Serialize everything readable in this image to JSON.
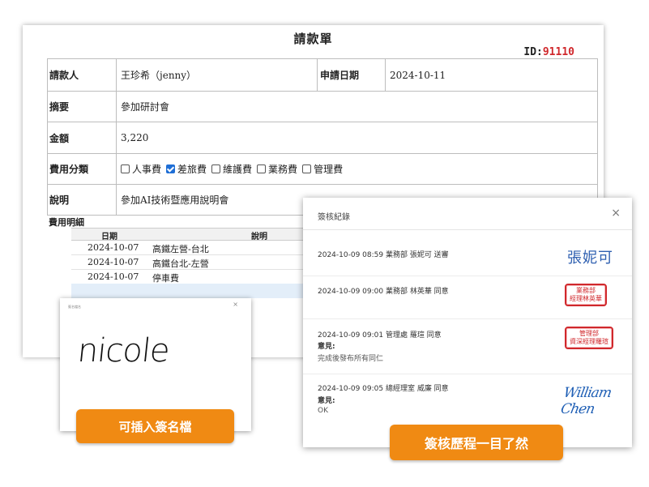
{
  "form": {
    "title": "請款單",
    "id_label": "ID:",
    "id_value": "91110",
    "applicant_label": "請款人",
    "applicant_value": "王珍希（jenny）",
    "date_label": "申請日期",
    "date_value": "2024-10-11",
    "summary_label": "摘要",
    "summary_value": "參加研討會",
    "amount_label": "金額",
    "amount_value": "3,220",
    "category_label": "費用分類",
    "categories": [
      {
        "label": "人事費",
        "checked": false
      },
      {
        "label": "差旅費",
        "checked": true
      },
      {
        "label": "維護費",
        "checked": false
      },
      {
        "label": "業務費",
        "checked": false
      },
      {
        "label": "管理費",
        "checked": false
      }
    ],
    "desc_label": "說明",
    "desc_value": "參加AI技術暨應用說明會"
  },
  "expenses": {
    "title": "費用明細",
    "col_date": "日期",
    "col_desc": "說明",
    "rows": [
      {
        "date": "2024-10-07",
        "desc": "高鐵左營-台北"
      },
      {
        "date": "2024-10-07",
        "desc": "高鐵台北-左營"
      },
      {
        "date": "2024-10-07",
        "desc": "停車費"
      }
    ]
  },
  "signature_dialog": {
    "header": "簽名檔名",
    "close": "×",
    "signature": "nicole"
  },
  "pill_left": "可插入簽名檔",
  "pill_right": "簽核歷程一目了然",
  "approval_modal": {
    "title": "簽核紀錄",
    "close": "×",
    "records": [
      {
        "line": "2024-10-09 08:59  業務部  張妮可  送審",
        "opinion_label": "",
        "comment": "",
        "sign": "張妮可"
      },
      {
        "line": "2024-10-09 09:00  業務部  林英華  同意",
        "opinion_label": "",
        "comment": "",
        "stamp1": "業務部",
        "stamp2": "經理林英華"
      },
      {
        "line": "2024-10-09 09:01  管理處  羅瑄  同意",
        "opinion_label": "意見:",
        "comment": "完成後發布所有同仁",
        "stamp1": "管理部",
        "stamp2": "資深經理羅瑄"
      },
      {
        "line": "2024-10-09 09:05  總經理室  威廉  同意",
        "opinion_label": "意見:",
        "comment": "OK",
        "sign": "William Chen"
      }
    ]
  },
  "colors": {
    "accent": "#f08a13",
    "id_red": "#d0282c",
    "stamp_red": "#d0282c",
    "sign_blue": "#2e5fb0"
  }
}
